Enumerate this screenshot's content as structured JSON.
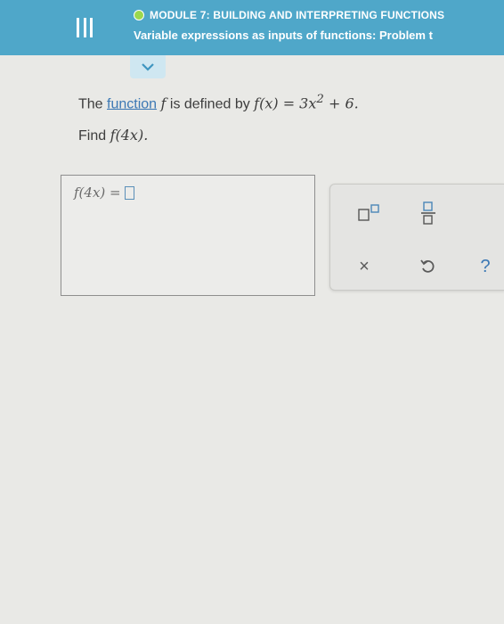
{
  "header": {
    "module_title": "MODULE 7: BUILDING AND INTERPRETING FUNCTIONS",
    "subtitle": "Variable expressions as inputs of functions: Problem t",
    "status_color": "#9bd84e",
    "menu_icon": "menu-icon"
  },
  "expand_tab": {
    "icon": "chevron-down-icon"
  },
  "problem": {
    "intro_text": "The ",
    "link_text": "function",
    "defined_text": " is defined by ",
    "function_name": "f",
    "definition_lhs": "f(x) = 3x",
    "definition_exponent": "2",
    "definition_rhs": " + 6.",
    "find_label": "Find ",
    "find_expression": "f(4x)."
  },
  "answer": {
    "prefix": "f(4x) ="
  },
  "toolpad": {
    "exponent_tool": "exponent-icon",
    "fraction_tool": "fraction-icon",
    "clear_symbol": "×",
    "undo_tool": "undo-icon",
    "help_symbol": "?"
  },
  "colors": {
    "header_bg": "#4fa7c9",
    "link": "#3c78b4",
    "input_slot": "#5a8fb8"
  }
}
